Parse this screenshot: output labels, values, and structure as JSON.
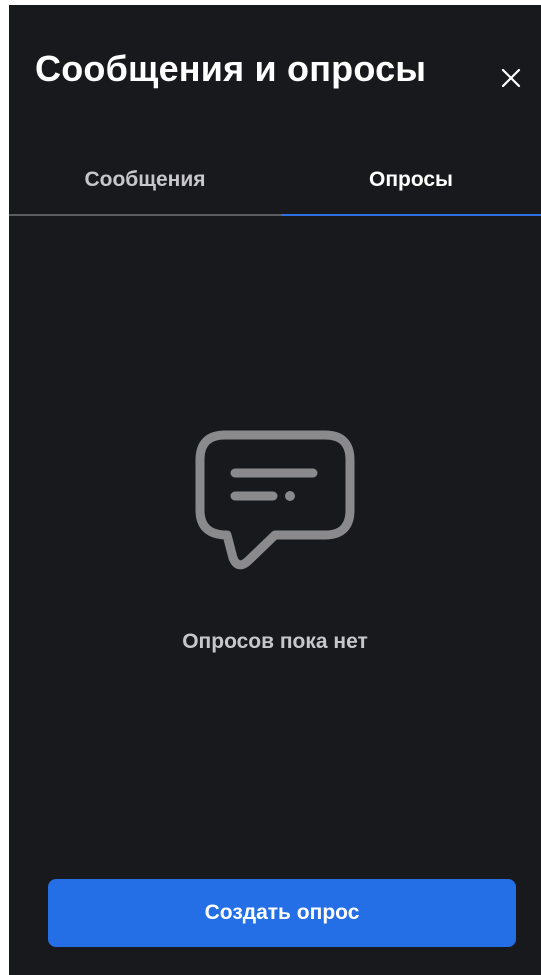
{
  "header": {
    "title": "Сообщения и опросы"
  },
  "tabs": [
    {
      "label": "Сообщения",
      "active": false
    },
    {
      "label": "Опросы",
      "active": true
    }
  ],
  "empty_state": {
    "icon": "chat-bubble-icon",
    "text": "Опросов пока нет"
  },
  "footer": {
    "button_label": "Создать опрос"
  },
  "colors": {
    "background": "#18191c",
    "accent": "#246fe6",
    "text_primary": "#ffffff",
    "text_secondary": "#c7c7c9",
    "icon_gray": "#8a8a8c"
  }
}
